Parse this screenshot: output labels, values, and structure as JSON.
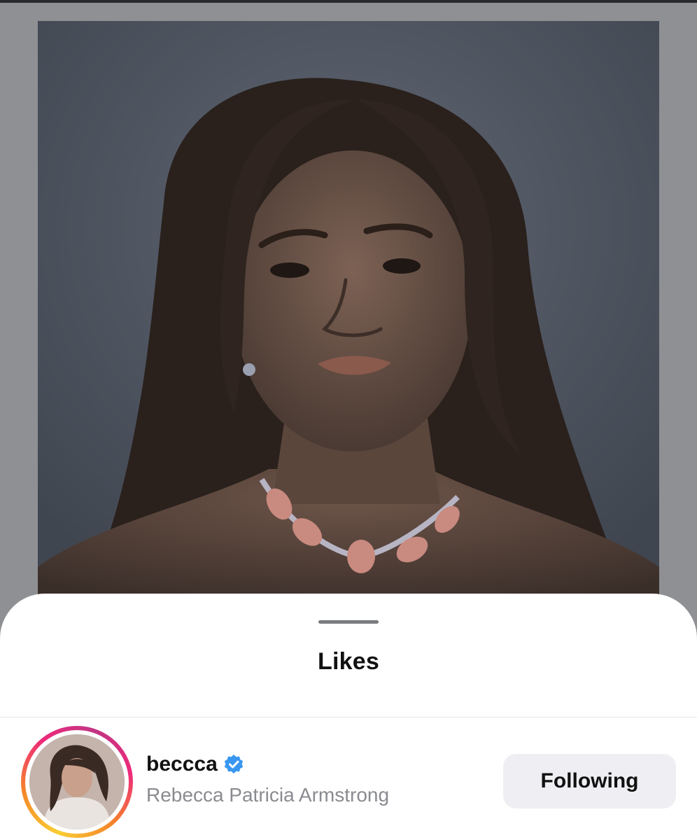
{
  "post": {
    "image_icon": "portrait-photo"
  },
  "sheet": {
    "title": "Likes"
  },
  "likes": [
    {
      "username": "beccca",
      "full_name": "Rebecca Patricia Armstrong",
      "verified": true,
      "follow_state": "Following",
      "avatar_icon": "profile-photo"
    }
  ],
  "colors": {
    "verified_badge": "#3897f0",
    "button_bg": "#efeff3",
    "secondary_text": "#8a8b90"
  }
}
